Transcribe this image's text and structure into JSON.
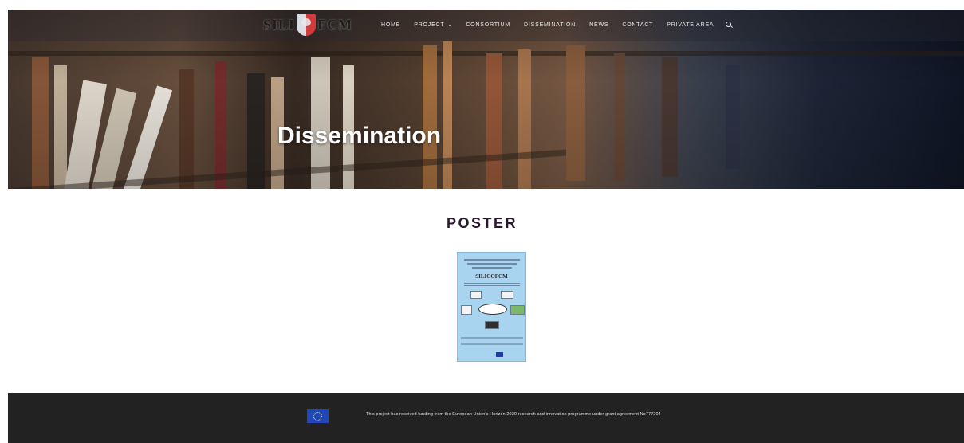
{
  "header": {
    "logo_text_left": "SILI",
    "logo_text_mid": "CO",
    "logo_text_right": "FCM",
    "nav": [
      {
        "label": "HOME"
      },
      {
        "label": "PROJECT",
        "has_dropdown": true
      },
      {
        "label": "CONSORTIUM"
      },
      {
        "label": "DISSEMINATION"
      },
      {
        "label": "NEWS"
      },
      {
        "label": "CONTACT"
      },
      {
        "label": "PRIVATE AREA"
      }
    ],
    "search_icon": "search-icon"
  },
  "hero": {
    "title": "Dissemination"
  },
  "main": {
    "heading": "POSTER",
    "poster_logo": "SILICOFCM"
  },
  "footer": {
    "funding_text": "This project has received funding from the European Union’s Horizon 2020 research and innovation programme under grant agreement No777204",
    "flag_icon": "eu-flag-icon"
  }
}
